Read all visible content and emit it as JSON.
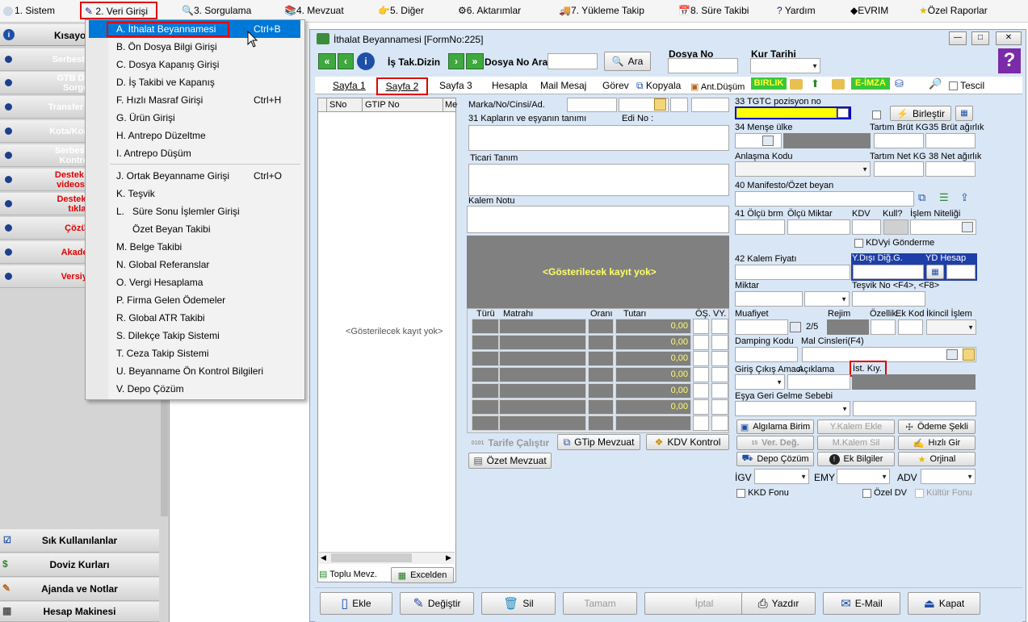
{
  "menubar": {
    "items": [
      {
        "label": "1.   Sistem"
      },
      {
        "label": "2.  Veri Girişi"
      },
      {
        "label": "3.   Sorgulama"
      },
      {
        "label": "4.   Mevzuat"
      },
      {
        "label": "5.   Diğer"
      },
      {
        "label": "6.   Aktarımlar"
      },
      {
        "label": "7.   Yükleme Takip"
      },
      {
        "label": "8. Süre Takibi"
      },
      {
        "label": "Yardım"
      },
      {
        "label": "EVRIM"
      },
      {
        "label": "Özel Raporlar"
      }
    ]
  },
  "dropdown": {
    "items": [
      {
        "label": "A.   İthalat Beyannamesi",
        "shortcut": "Ctrl+B"
      },
      {
        "label": "B.   Ön Dosya Bilgi Girişi",
        "shortcut": ""
      },
      {
        "label": "C.   Dosya Kapanış Girişi",
        "shortcut": ""
      },
      {
        "label": "D.   İş Takibi ve Kapanış",
        "shortcut": ""
      },
      {
        "label": "F.   Hızlı Masraf Girişi",
        "shortcut": "Ctrl+H"
      },
      {
        "label": "G.   Ürün Girişi",
        "shortcut": ""
      },
      {
        "label": "H.   Antrepo Düzeltme",
        "shortcut": ""
      },
      {
        "label": "I.    Antrepo Düşüm",
        "shortcut": ""
      },
      {
        "label": "J.   Ortak Beyanname Girişi",
        "shortcut": "Ctrl+O"
      },
      {
        "label": "K.   Teşvik",
        "shortcut": ""
      },
      {
        "label": "L.   Süre Sonu İşlemler Girişi",
        "shortcut": ""
      },
      {
        "label": "      Özet Beyan Takibi",
        "shortcut": ""
      },
      {
        "label": "M.   Belge Takibi",
        "shortcut": ""
      },
      {
        "label": "N.  Global Referanslar",
        "shortcut": ""
      },
      {
        "label": "O. Vergi Hesaplama",
        "shortcut": ""
      },
      {
        "label": "P. Firma Gelen Ödemeler",
        "shortcut": ""
      },
      {
        "label": "R. Global ATR Takibi",
        "shortcut": ""
      },
      {
        "label": "S. Dilekçe Takip Sistemi",
        "shortcut": ""
      },
      {
        "label": "T. Ceza Takip Sistemi",
        "shortcut": ""
      },
      {
        "label": "U. Beyanname Ön Kontrol Bilgileri",
        "shortcut": ""
      },
      {
        "label": "V. Depo Çözüm",
        "shortcut": ""
      }
    ]
  },
  "sidebar": {
    "header": "Kısayo",
    "items": [
      {
        "label": "Serbest Bölg",
        "color": "#ffffff"
      },
      {
        "label": "GTB DIR B\nSorgula",
        "color": "#ffffff"
      },
      {
        "label": "Transfer Bildiri",
        "color": "#ffffff"
      },
      {
        "label": "Kota/Kontenja",
        "color": "#ffffff"
      },
      {
        "label": "Serbest Böl\nKontrol Ü",
        "color": "#ffffff"
      },
      {
        "label": "Destek Port\nvideosu içi",
        "color": "#e00000"
      },
      {
        "label": "Destek Vid\ntıklay",
        "color": "#e00000"
      },
      {
        "label": "Çözüm",
        "color": "#e00000"
      },
      {
        "label": "Akademi",
        "color": "#e00000"
      },
      {
        "label": "Versiyon",
        "color": "#e00000"
      }
    ],
    "bottom": [
      "Sık Kullanılanlar",
      "Doviz Kurları",
      "Ajanda ve Notlar",
      "Hesap Makinesi"
    ]
  },
  "form": {
    "title": "İthalat Beyannamesi [FormNo:225]",
    "nav": {
      "is_takip": "İş Tak.Dizin",
      "dosya_no_ara": "Dosya No Ara",
      "ara_button": "Ara",
      "dosya_no": "Dosya No",
      "kur_tarihi": "Kur Tarihi"
    },
    "tabs": [
      "Sayfa 1",
      "Sayfa 2",
      "Sayfa 3",
      "Hesapla",
      "Mail Mesaj",
      "Görev",
      "Kopyala",
      "Ant.Düşüm"
    ],
    "toolbar_badges": {
      "birlik": "BIRLIK",
      "eimza": "E-İMZA",
      "tescil": "Tescil"
    },
    "left_grid": {
      "columns": [
        "SNo",
        "GTIP No",
        "Me"
      ],
      "empty": "<Gösterilecek kayıt yok>",
      "toplu_mevz": "Toplu Mevz.",
      "excelden": "Excelden"
    },
    "mid": {
      "marka": "Marka/No/Cinsi/Ad.",
      "kaplar": "31 Kapların ve eşyanın tanımı",
      "edi_no": "Edi No :",
      "ticari_tanim": "Ticari Tanım",
      "kalem_notu": "Kalem Notu",
      "gray_empty": "<Gösterilecek kayıt yok>",
      "tax_columns": [
        "Türü",
        "Matrahı",
        "Oranı",
        "Tutarı",
        "ÖŞ.",
        "VY."
      ],
      "tax_values": [
        "0,00",
        "0,00",
        "0,00",
        "0,00",
        "0,00",
        "0,00"
      ],
      "tarife_calistir": "Tarife Çalıştır",
      "gtip_mevzuat": "GTip Mevzuat",
      "kdv_kontrol": "KDV Kontrol",
      "ozet_mevzuat": "Özet Mevzuat"
    },
    "right": {
      "tgtc": "33 TGTC pozisyon no",
      "birlestir": "Birleştir",
      "mense": "34 Menşe ülke",
      "tartim_brut": "Tartım Brüt KG",
      "brut_agirlik": "35 Brüt ağırlık",
      "anlasma": "Anlaşma Kodu",
      "tartim_net": "Tartım Net KG",
      "net_agirlik": "38 Net ağırlık",
      "manifesto": "40 Manifesto/Özet beyan",
      "olcu_brm": "41 Ölçü brm",
      "olcu_miktar": "Ölçü Miktar",
      "kdv": "KDV",
      "kull": "Kull?",
      "islem_niteligi": "İşlem Niteliği",
      "kdvyi_gonderme": "KDVyi Gönderme",
      "kalem_fiyati": "42 Kalem Fiyatı",
      "ydisi_dig": "Y.Dışı Diğ.G.",
      "yd_hesap": "YD Hesap",
      "miktar": "Miktar",
      "tesvik_no": "Teşvik No <F4>, <F8>",
      "muafiyet": "Muafiyet",
      "page_indicator": "2/5",
      "rejim": "Rejim",
      "ozellik": "Özellik",
      "ek_kod": "Ek Kod",
      "ikincil_islem": "İkincil İşlem",
      "damping_kodu": "Damping Kodu",
      "mal_cinsleri": "Mal Cinsleri(F4)",
      "giris_cikis": "Giriş Çıkış Amacı",
      "aciklama": "Açıklama",
      "ist_kiy": "İst. Kıy.",
      "esya_geri": "Eşya Geri Gelme Sebebi",
      "alginlama_birim": "Algılama Birim",
      "y_kalem_ekle": "Y.Kalem Ekle",
      "odeme_sekli": "Ödeme Şekli",
      "ver_deg": "Ver. Değ.",
      "m_kalem_sil": "M.Kalem Sil",
      "hizli_gir": "Hızlı Gir",
      "depo_cozum": "Depo Çözüm",
      "ek_bilgiler": "Ek Bilgiler",
      "orjinal": "Orjinal",
      "igv": "İGV",
      "emy": "EMY",
      "adv": "ADV",
      "kkd_fonu": "KKD Fonu",
      "ozel_dv": "Özel DV",
      "kultur_fonu": "Kültür Fonu"
    },
    "bottom_buttons": [
      "Ekle",
      "Değiştir",
      "Sil",
      "Tamam",
      "İptal",
      "Yazdır",
      "E-Mail",
      "Kapat"
    ]
  },
  "colors": {
    "menu_highlight": "#0078d7",
    "red_box": "#e00000",
    "form_bg": "#d9e6f5",
    "gray_grid": "#808080",
    "yellow_text": "#ffff66",
    "tgtc_bar": "#0000ff",
    "selection": "#1e3fa8"
  }
}
